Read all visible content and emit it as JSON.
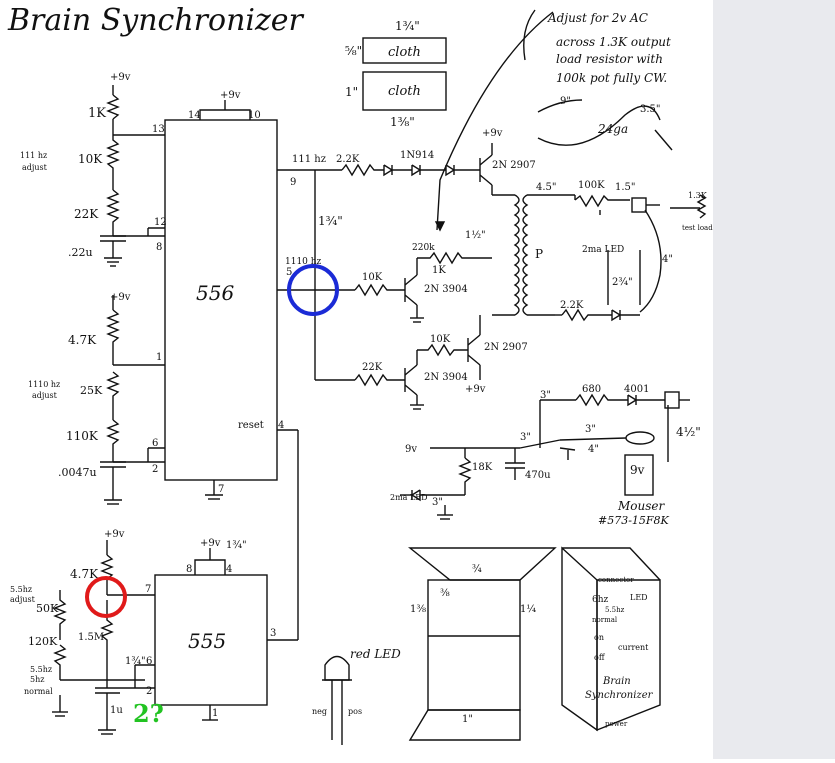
{
  "title": "Brain Synchronizer",
  "notes": {
    "adjust": [
      "Adjust for 2v AC",
      "across 1.3K output",
      "load resistor with",
      "100k pot fully CW."
    ],
    "cloth_top": "cloth",
    "cloth_bottom": "cloth",
    "dim_1_3_4": "1¾\"",
    "dim_5_8": "⅝\"",
    "dim_1": "1\"",
    "dim_1_3_8": "1⅜\"",
    "cable_9": "9\"",
    "cable_3_5": "3.5\"",
    "gauge": "24ga"
  },
  "chips": {
    "c556": "556",
    "c555": "555"
  },
  "labels": {
    "plus9v": "+9v",
    "r1k": "1K",
    "pot10k": "10K",
    "adj111": "111 hz",
    "adj111b": "adjust",
    "r22k": "22K",
    "c22u": ".22u",
    "r47k": "4.7K",
    "pot25k": "25K",
    "adj1110": "1110 hz",
    "adj1110b": "adjust",
    "r110k": "110K",
    "c0047": ".0047u",
    "pin13": "13",
    "pin12": "12",
    "pin8": "8",
    "pin1": "1",
    "pin6": "6",
    "pin2": "2",
    "pin14": "14",
    "pin10": "10",
    "pin9": "9",
    "pin7": "7",
    "pin5": "5",
    "pin4": "4",
    "reset": "reset",
    "f111": "111 hz",
    "f1110": "1110 hz",
    "r22k_top": "2.2K",
    "d1n914": "1N914",
    "q2n2907a": "2N 2907",
    "dim_134": "1¾\"",
    "dim_112": "1½\"",
    "r220": "220k",
    "r1k_pot": "1K",
    "r10k": "10K",
    "q2n3904a": "2N 3904",
    "r10k_b": "10K",
    "q2n2907b": "2N 2907",
    "r22k_b": "22K",
    "q2n3904b": "2N 3904",
    "plus9v_b": "+9v",
    "d45": "4.5\"",
    "pot100k": "100K",
    "d15": "1.5\"",
    "r13k": "1.3K",
    "testload": "test load",
    "p": "P",
    "led2ma": "2ma LED",
    "dim234": "2¾\"",
    "dim4": "4\"",
    "r22k_c": "2.2K",
    "d3": "3\"",
    "r680": "680",
    "d4001": "4001",
    "d4half": "4½\"",
    "v9": "9v",
    "d3b": "3\"",
    "d3c": "3\"",
    "d4": "4\"",
    "r18k": "18K",
    "c470": "470u",
    "led2ma_b": "2ma LED",
    "d3d": "3\"",
    "mouser": "Mouser",
    "part": "#573-15F8K",
    "r47k_555": "4.7K",
    "adj55": "5.5hz",
    "adj55b": "adjust",
    "pot50k": "50K",
    "r120k": "120K",
    "r15m": "1.5M",
    "sw55": "5.5hz",
    "sw5": "5hz",
    "sw_normal": "normal",
    "c1u": "1u",
    "q_mark": "2?",
    "pin8_555": "8",
    "pin4_555": "4",
    "pin7_555": "7",
    "pin6_555": "6",
    "pin2_555": "2",
    "pin3_555": "3",
    "pin1_555": "1",
    "dim134_555": "1¾\"",
    "dim134_555b": "1¾\"",
    "red_led": "red LED",
    "neg": "neg",
    "pos": "pos",
    "box_dim_a": "1⅜",
    "box_dim_b": "¾",
    "box_dim_c": "⅜",
    "box_dim_d": "1¼",
    "box_dim_e": "1\"",
    "panel_title1": "Brain",
    "panel_title2": "Synchronizer",
    "panel_6hz": "6hz",
    "panel_55hz": "5.5hz",
    "panel_normal": "normal",
    "panel_led": "LED",
    "panel_on": "on",
    "panel_off": "off",
    "panel_current": "current",
    "panel_power": "power",
    "panel_connector": "connector"
  },
  "colors": {
    "blue_circle": "#1b2bd6",
    "red_circle": "#e01a1a",
    "green_text": "#22c322",
    "sidebar": "#e9eaee"
  }
}
